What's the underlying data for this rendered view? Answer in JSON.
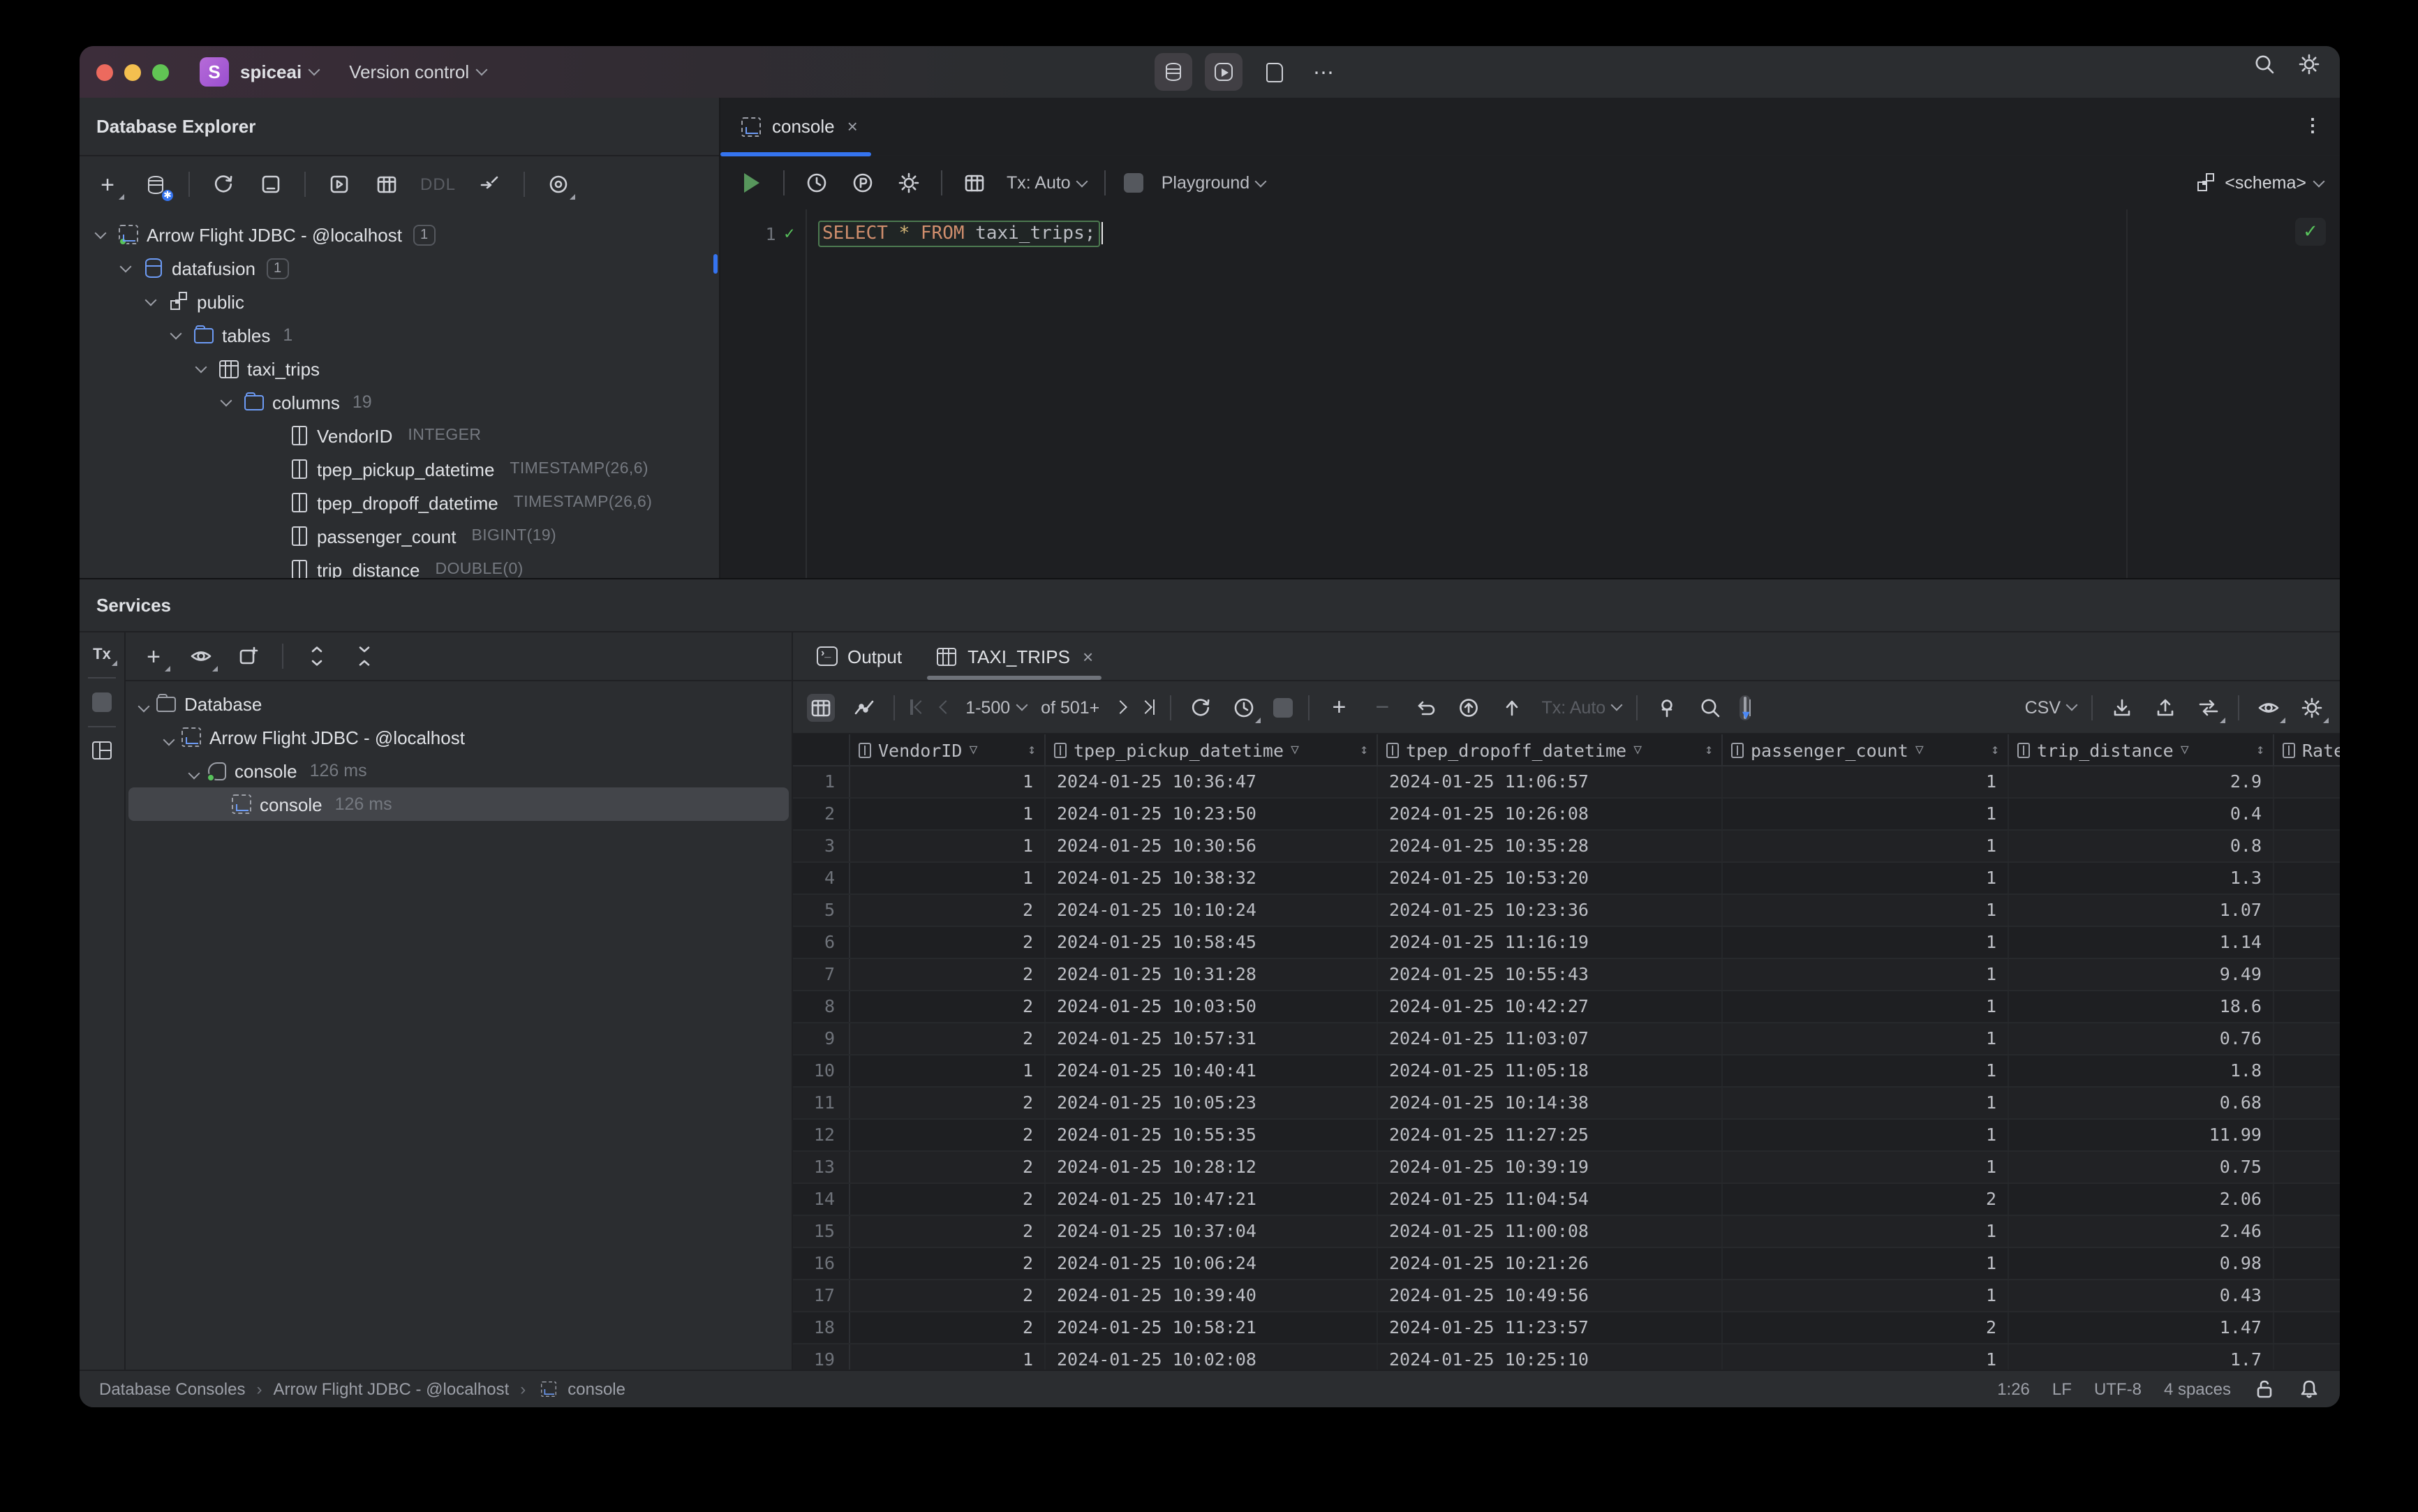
{
  "titlebar": {
    "project_initial": "S",
    "project_name": "spiceai",
    "version_control_label": "Version control",
    "more_label": "⋯",
    "icons": [
      "database-icon",
      "run-profile-icon",
      "folder-icon",
      "more-icon",
      "search-icon",
      "settings-icon"
    ]
  },
  "database_explorer": {
    "title": "Database Explorer",
    "toolbar": {
      "ddl_label": "DDL",
      "icons": [
        "add-icon",
        "datasource-settings-icon",
        "refresh-icon",
        "new-console-icon",
        "run-icon",
        "table-icon",
        "ddl-button",
        "jump-to-icon",
        "scope-icon"
      ]
    },
    "tree": [
      {
        "label": "Arrow Flight JDBC - @localhost",
        "badge": "1",
        "icon": "console-run",
        "indent": 0,
        "chevron": "true"
      },
      {
        "label": "datafusion",
        "badge": "1",
        "icon": "db",
        "indent": 1,
        "chevron": "true"
      },
      {
        "label": "public",
        "icon": "schema",
        "indent": 2,
        "chevron": "true"
      },
      {
        "label": "tables",
        "meta": "1",
        "icon": "folder",
        "indent": 3,
        "chevron": "true"
      },
      {
        "label": "taxi_trips",
        "icon": "table",
        "indent": 4,
        "chevron": "true"
      },
      {
        "label": "columns",
        "meta": "19",
        "icon": "folder",
        "indent": 5,
        "chevron": "true"
      },
      {
        "label": "VendorID",
        "type": "INTEGER",
        "icon": "column",
        "indent": 6
      },
      {
        "label": "tpep_pickup_datetime",
        "type": "TIMESTAMP(26,6)",
        "icon": "column",
        "indent": 6
      },
      {
        "label": "tpep_dropoff_datetime",
        "type": "TIMESTAMP(26,6)",
        "icon": "column",
        "indent": 6
      },
      {
        "label": "passenger_count",
        "type": "BIGINT(19)",
        "icon": "column",
        "indent": 6
      },
      {
        "label": "trip_distance",
        "type": "DOUBLE(0)",
        "icon": "column",
        "indent": 6
      }
    ]
  },
  "editor": {
    "tab_label": "console",
    "close_label": "×",
    "kebab_label": "⋮",
    "toolbar": {
      "tx_label": "Tx: Auto",
      "profile_label": "Playground",
      "schema_label": "<schema>"
    },
    "line_number": "1",
    "gutter_check": "✓",
    "code": {
      "kw1": "SELECT",
      "star": "*",
      "kw2": "FROM",
      "table": "taxi_trips",
      "semi": ";"
    },
    "inspection_ok": "✓"
  },
  "services": {
    "title": "Services",
    "rail_tx_label": "Tx",
    "tree": [
      {
        "label": "Database",
        "icon": "folder-gray",
        "indent": 0,
        "chevron": "true"
      },
      {
        "label": "Arrow Flight JDBC - @localhost",
        "icon": "console",
        "indent": 1,
        "chevron": "true"
      },
      {
        "label": "console",
        "meta": "126 ms",
        "icon": "plug",
        "indent": 2,
        "chevron": "true"
      },
      {
        "label": "console",
        "meta": "126 ms",
        "icon": "console",
        "indent": 3,
        "selected": "true"
      }
    ]
  },
  "results": {
    "tab_output": "Output",
    "tab_table": "TAXI_TRIPS",
    "close_label": "×",
    "toolbar": {
      "page_range": "1-500",
      "page_total": "of 501+",
      "tx_label": "Tx: Auto",
      "export_format": "CSV"
    },
    "grid": {
      "columns": [
        "VendorID",
        "tpep_pickup_datetime",
        "tpep_dropoff_datetime",
        "passenger_count",
        "trip_distance",
        "Rate"
      ],
      "funnel_glyph": "▽",
      "sort_glyph": "↕",
      "rows": [
        {
          "num": "1",
          "c1": "1",
          "c2": "2024-01-25 10:36:47",
          "c3": "2024-01-25 11:06:57",
          "c4": "1",
          "c5": "2.9"
        },
        {
          "num": "2",
          "c1": "1",
          "c2": "2024-01-25 10:23:50",
          "c3": "2024-01-25 10:26:08",
          "c4": "1",
          "c5": "0.4"
        },
        {
          "num": "3",
          "c1": "1",
          "c2": "2024-01-25 10:30:56",
          "c3": "2024-01-25 10:35:28",
          "c4": "1",
          "c5": "0.8"
        },
        {
          "num": "4",
          "c1": "1",
          "c2": "2024-01-25 10:38:32",
          "c3": "2024-01-25 10:53:20",
          "c4": "1",
          "c5": "1.3"
        },
        {
          "num": "5",
          "c1": "2",
          "c2": "2024-01-25 10:10:24",
          "c3": "2024-01-25 10:23:36",
          "c4": "1",
          "c5": "1.07"
        },
        {
          "num": "6",
          "c1": "2",
          "c2": "2024-01-25 10:58:45",
          "c3": "2024-01-25 11:16:19",
          "c4": "1",
          "c5": "1.14"
        },
        {
          "num": "7",
          "c1": "2",
          "c2": "2024-01-25 10:31:28",
          "c3": "2024-01-25 10:55:43",
          "c4": "1",
          "c5": "9.49"
        },
        {
          "num": "8",
          "c1": "2",
          "c2": "2024-01-25 10:03:50",
          "c3": "2024-01-25 10:42:27",
          "c4": "1",
          "c5": "18.6"
        },
        {
          "num": "9",
          "c1": "2",
          "c2": "2024-01-25 10:57:31",
          "c3": "2024-01-25 11:03:07",
          "c4": "1",
          "c5": "0.76"
        },
        {
          "num": "10",
          "c1": "1",
          "c2": "2024-01-25 10:40:41",
          "c3": "2024-01-25 11:05:18",
          "c4": "1",
          "c5": "1.8"
        },
        {
          "num": "11",
          "c1": "2",
          "c2": "2024-01-25 10:05:23",
          "c3": "2024-01-25 10:14:38",
          "c4": "1",
          "c5": "0.68"
        },
        {
          "num": "12",
          "c1": "2",
          "c2": "2024-01-25 10:55:35",
          "c3": "2024-01-25 11:27:25",
          "c4": "1",
          "c5": "11.99"
        },
        {
          "num": "13",
          "c1": "2",
          "c2": "2024-01-25 10:28:12",
          "c3": "2024-01-25 10:39:19",
          "c4": "1",
          "c5": "0.75"
        },
        {
          "num": "14",
          "c1": "2",
          "c2": "2024-01-25 10:47:21",
          "c3": "2024-01-25 11:04:54",
          "c4": "2",
          "c5": "2.06"
        },
        {
          "num": "15",
          "c1": "2",
          "c2": "2024-01-25 10:37:04",
          "c3": "2024-01-25 11:00:08",
          "c4": "1",
          "c5": "2.46"
        },
        {
          "num": "16",
          "c1": "2",
          "c2": "2024-01-25 10:06:24",
          "c3": "2024-01-25 10:21:26",
          "c4": "1",
          "c5": "0.98"
        },
        {
          "num": "17",
          "c1": "2",
          "c2": "2024-01-25 10:39:40",
          "c3": "2024-01-25 10:49:56",
          "c4": "1",
          "c5": "0.43"
        },
        {
          "num": "18",
          "c1": "2",
          "c2": "2024-01-25 10:58:21",
          "c3": "2024-01-25 11:23:57",
          "c4": "2",
          "c5": "1.47"
        },
        {
          "num": "19",
          "c1": "1",
          "c2": "2024-01-25 10:02:08",
          "c3": "2024-01-25 10:25:10",
          "c4": "1",
          "c5": "1.7"
        }
      ]
    }
  },
  "status_bar": {
    "crumb1": "Database Consoles",
    "crumb2": "Arrow Flight JDBC - @localhost",
    "crumb3": "console",
    "separator": "›",
    "caret_position": "1:26",
    "line_ending": "LF",
    "encoding": "UTF-8",
    "indent_style": "4 spaces"
  },
  "colors": {
    "accent_blue": "#3574f0",
    "green": "#57c25b",
    "keyword_orange": "#cf8e6d",
    "panel_bg": "#2b2d30",
    "editor_bg": "#1e1f22"
  }
}
